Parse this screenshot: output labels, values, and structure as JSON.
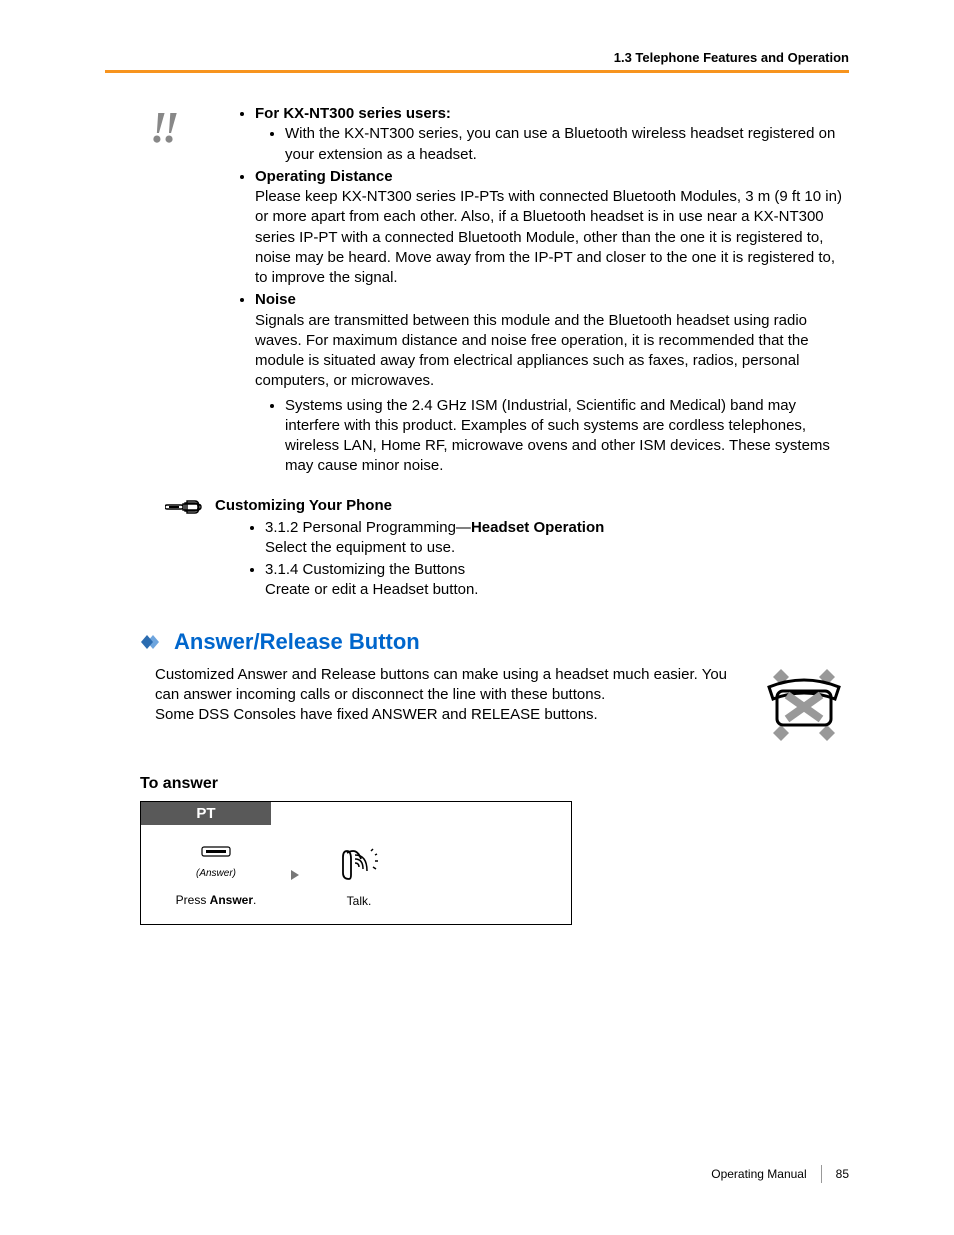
{
  "header": {
    "section": "1.3 Telephone Features and Operation"
  },
  "notes": {
    "item1": {
      "title": "For KX-NT300 series users:",
      "sub1": "With the KX-NT300 series, you can use a Bluetooth wireless headset registered on your extension as a headset."
    },
    "item2": {
      "title": "Operating Distance",
      "body": "Please keep KX-NT300 series IP-PTs with connected Bluetooth Modules, 3 m (9 ft 10 in) or more apart from each other. Also, if a Bluetooth headset is in use near a KX-NT300 series IP-PT with a connected Bluetooth Module, other than the one it is registered to, noise may be heard. Move away from the IP-PT and closer to the one it is registered to, to improve the signal."
    },
    "item3": {
      "title": "Noise",
      "body": "Signals are transmitted between this module and the Bluetooth headset using radio waves. For maximum distance and noise free operation, it is recommended that the module is situated away from electrical appliances such as faxes, radios, personal computers, or microwaves.",
      "sub1": "Systems using the 2.4 GHz ISM (Industrial, Scientific and Medical) band may interfere with this product. Examples of such systems are cordless telephones, wireless LAN, Home RF, microwave ovens and other ISM devices. These systems may cause minor noise."
    }
  },
  "customizing": {
    "title": "Customizing Your Phone",
    "item1_pre": "3.1.2 Personal Programming—",
    "item1_bold": "Headset Operation",
    "item1_line2": "Select the equipment to use.",
    "item2_line1": "3.1.4 Customizing the Buttons",
    "item2_line2": "Create or edit a Headset button."
  },
  "section": {
    "title": "Answer/Release Button",
    "body1": "Customized Answer and Release buttons can make using a headset much easier. You can answer incoming calls or disconnect the line with these buttons.",
    "body2": "Some DSS Consoles have fixed ANSWER and RELEASE buttons."
  },
  "procedure": {
    "heading": "To answer",
    "pt": "PT",
    "answer_label": "(Answer)",
    "step1_pre": "Press ",
    "step1_bold": "Answer",
    "step1_post": ".",
    "step2": "Talk."
  },
  "footer": {
    "manual": "Operating Manual",
    "page": "85"
  }
}
